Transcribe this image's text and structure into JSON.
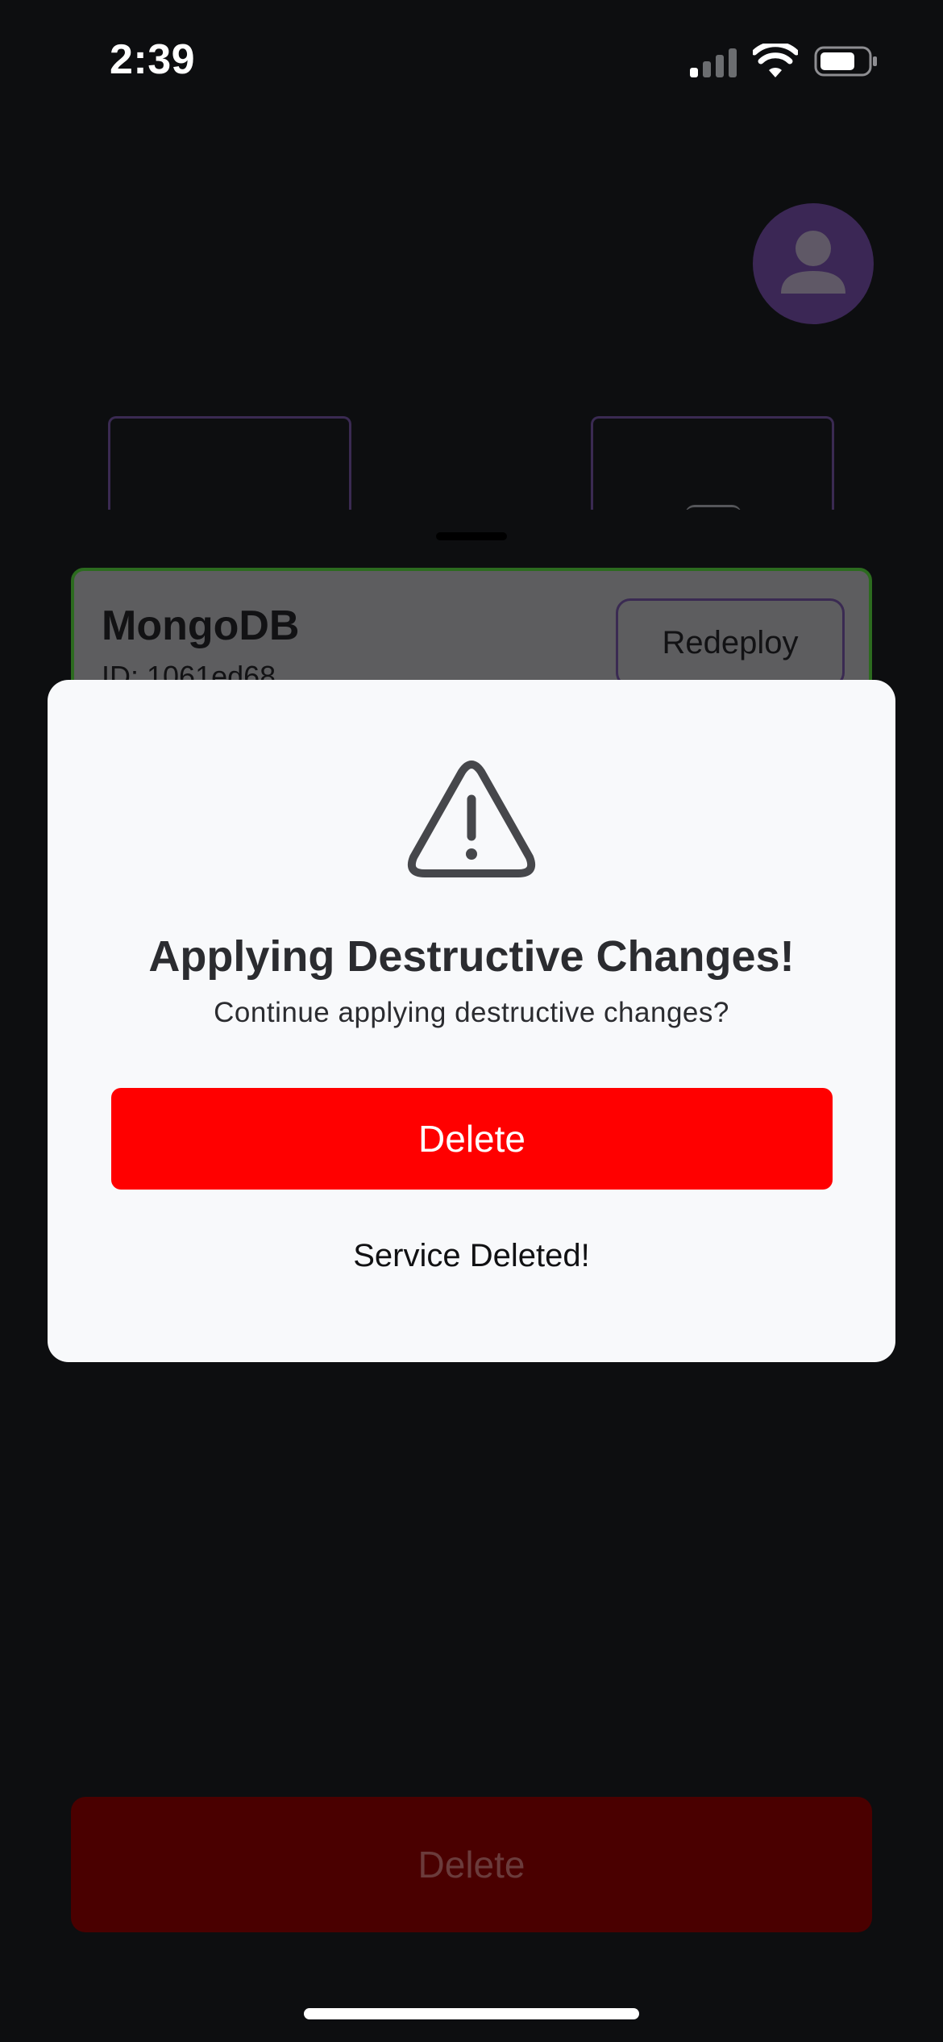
{
  "status_bar": {
    "time": "2:39"
  },
  "background": {
    "service_card": {
      "name": "MongoDB",
      "id_text": "ID: 1061ed68",
      "redeploy_label": "Redeploy"
    },
    "bottom_delete_label": "Delete"
  },
  "modal": {
    "icon": "warning-triangle-icon",
    "title": "Applying Destructive Changes!",
    "subtitle": "Continue applying destructive changes?",
    "delete_label": "Delete",
    "status_text": "Service Deleted!"
  },
  "colors": {
    "danger": "#ff0000",
    "card_border": "#2c6b1f",
    "avatar": "#3b2755",
    "modal_bg": "#f8f9fb"
  }
}
